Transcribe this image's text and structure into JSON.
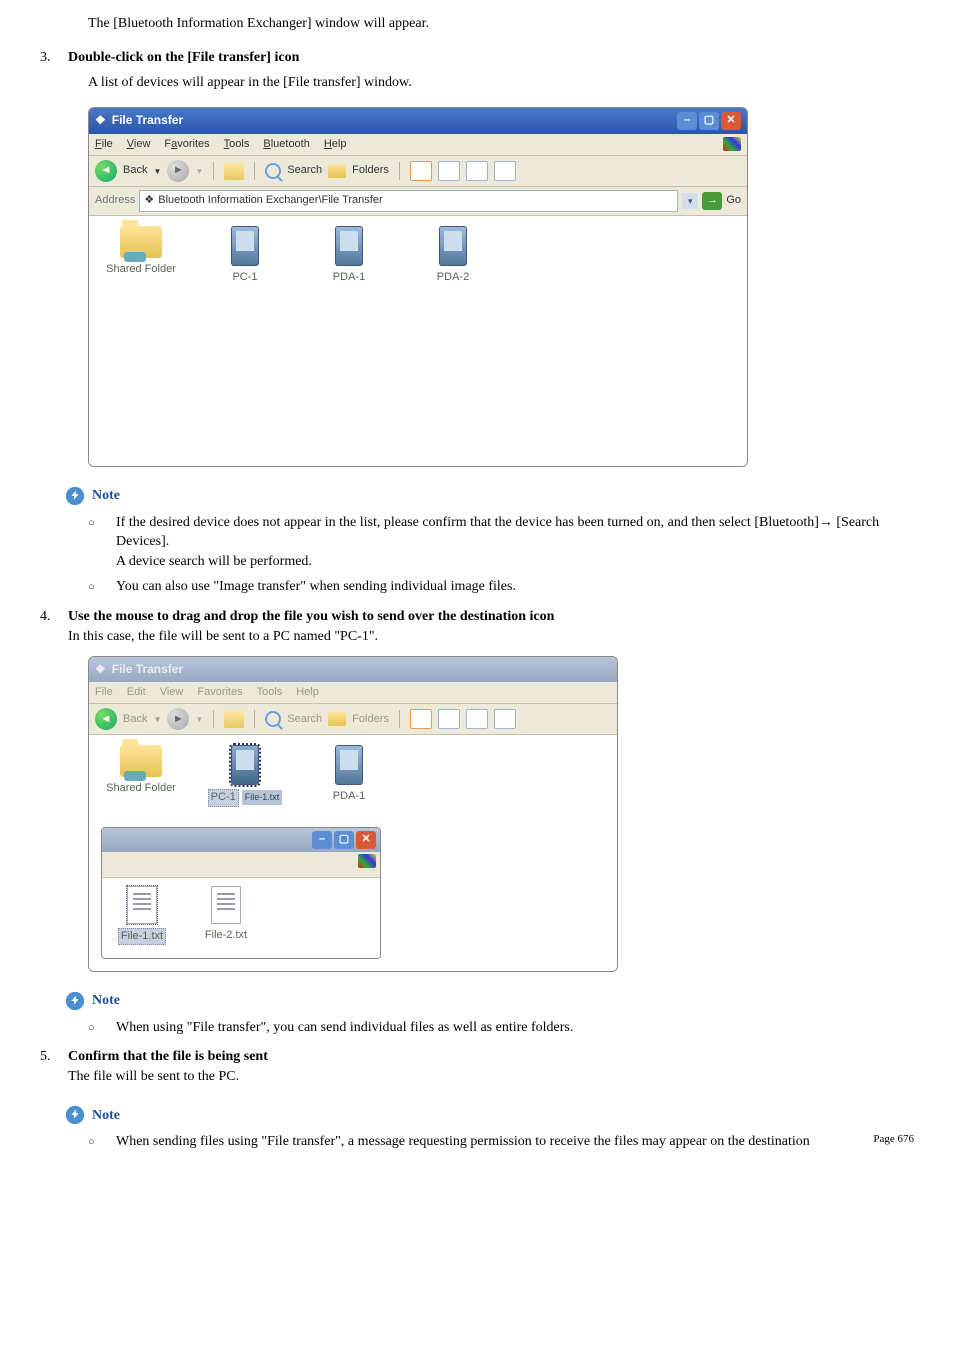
{
  "intro_line": "The [Bluetooth Information Exchanger] window will appear.",
  "step3": {
    "num": "3.",
    "title": "Double-click on the [File transfer] icon",
    "desc": "A list of devices will appear in the [File transfer] window."
  },
  "screenshot1": {
    "title": "File Transfer",
    "menu": {
      "file": "File",
      "view": "View",
      "favorites": "Favorites",
      "tools": "Tools",
      "bluetooth": "Bluetooth",
      "help": "Help"
    },
    "toolbar": {
      "back": "Back",
      "search": "Search",
      "folders": "Folders"
    },
    "address_label": "Address",
    "address_value": "Bluetooth Information Exchanger\\File Transfer",
    "go": "Go",
    "items": {
      "shared_folder": "Shared Folder",
      "pc1": "PC-1",
      "pda1": "PDA-1",
      "pda2": "PDA-2"
    }
  },
  "note_label": "Note",
  "note1": {
    "a": "If the desired device does not appear in the list, please confirm that the device has been turned on, and then select [Bluetooth]→ [Search Devices].",
    "a2": "A device search will be performed.",
    "b": "You can also use \"Image transfer\" when sending individual image files."
  },
  "step4": {
    "num": "4.",
    "title": "Use the mouse to drag and drop the file you wish to send over the destination icon",
    "desc": "In this case, the file will be sent to a PC named \"PC-1\"."
  },
  "screenshot2": {
    "title": "File Transfer",
    "menu": {
      "file": "File",
      "edit": "Edit",
      "view": "View",
      "favorites": "Favorites",
      "tools": "Tools",
      "help": "Help"
    },
    "toolbar": {
      "back": "Back",
      "search": "Search",
      "folders": "Folders"
    },
    "items": {
      "shared_folder": "Shared Folder",
      "pc1": "PC-1",
      "pda1": "PDA-1",
      "file_tag": "File-1.txt"
    },
    "inner": {
      "file1": "File-1.txt",
      "file2": "File-2.txt"
    }
  },
  "note2": {
    "a": "When using \"File transfer\", you can send individual files as well as entire folders."
  },
  "step5": {
    "num": "5.",
    "title": "Confirm that the file is being sent",
    "desc": "The file will be sent to the PC."
  },
  "note3": {
    "a": "When sending files using \"File transfer\", a message requesting permission to receive the files may appear on the destination"
  },
  "page_footer": "Page 676"
}
